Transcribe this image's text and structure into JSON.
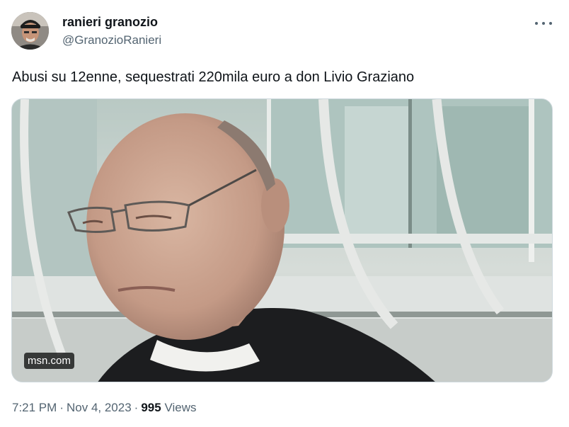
{
  "author": {
    "display_name": "ranieri granozio",
    "handle": "@GranozioRanieri"
  },
  "more_icon": "more-horizontal-icon",
  "tweet": {
    "text": "Abusi su 12enne, sequestrati 220mila euro a don Livio Graziano"
  },
  "media": {
    "source_badge": "msn.com"
  },
  "meta": {
    "time": "7:21 PM",
    "separator": "·",
    "date": "Nov 4, 2023",
    "views_count": "995",
    "views_label": "Views"
  },
  "colors": {
    "text_primary": "#0f1419",
    "text_secondary": "#536471",
    "border": "#cfd9de"
  }
}
